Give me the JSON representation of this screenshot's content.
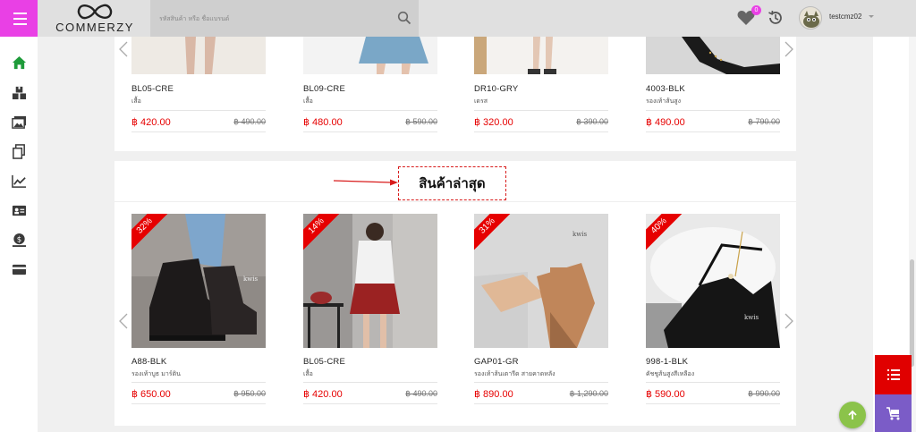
{
  "header": {
    "brand": "COMMERZY",
    "search_placeholder": "รหัสสินค้า หรือ ชื่อแบรนด์",
    "wishlist_count": "0",
    "username": "testcmz02"
  },
  "sidebar": {
    "items": [
      {
        "icon": "home-icon",
        "active": true
      },
      {
        "icon": "boxes-icon"
      },
      {
        "icon": "images-icon"
      },
      {
        "icon": "copy-icon"
      },
      {
        "icon": "chart-line-icon"
      },
      {
        "icon": "id-card-icon"
      },
      {
        "icon": "money-icon"
      },
      {
        "icon": "credit-card-icon"
      }
    ]
  },
  "top_products": [
    {
      "sku": "BL05-CRE",
      "desc": "เสื้อ",
      "price": "฿ 420.00",
      "old_price": "฿ 490.00"
    },
    {
      "sku": "BL09-CRE",
      "desc": "เสื้อ",
      "price": "฿ 480.00",
      "old_price": "฿ 590.00"
    },
    {
      "sku": "DR10-GRY",
      "desc": "เดรส",
      "price": "฿ 320.00",
      "old_price": "฿ 390.00"
    },
    {
      "sku": "4003-BLK",
      "desc": "รองเท้าส้นสูง",
      "price": "฿ 490.00",
      "old_price": "฿ 790.00"
    }
  ],
  "latest_section": {
    "title": "สินค้าล่าสุด",
    "products": [
      {
        "sku": "A88-BLK",
        "desc": "รองเท้าบูธ มาร์ติน",
        "price": "฿ 650.00",
        "old_price": "฿ 950.00",
        "discount": "32%"
      },
      {
        "sku": "BL05-CRE",
        "desc": "เสื้อ",
        "price": "฿ 420.00",
        "old_price": "฿ 490.00",
        "discount": "14%"
      },
      {
        "sku": "GAP01-GR",
        "desc": "รองเท้าส้นเตารีด สายคาดหลัง",
        "price": "฿ 890.00",
        "old_price": "฿ 1,290.00",
        "discount": "31%"
      },
      {
        "sku": "998-1-BLK",
        "desc": "คัชชูส้นสูงสีเหลือง",
        "price": "฿ 590.00",
        "old_price": "฿ 990.00",
        "discount": "40%"
      }
    ]
  },
  "colors": {
    "accent": "#e940e5",
    "price": "#e60000",
    "fab_red": "#e00000",
    "fab_purple": "#7b5cc7",
    "fab_green": "#8bc34a",
    "active_icon": "#1e9b3a"
  }
}
